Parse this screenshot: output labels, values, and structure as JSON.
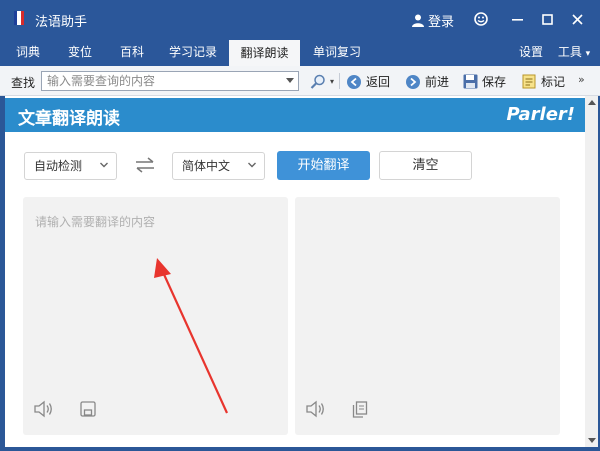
{
  "window": {
    "title": "法语助手",
    "login": "登录"
  },
  "nav": {
    "tabs": [
      "词典",
      "变位",
      "百科",
      "学习记录",
      "翻译朗读",
      "单词复习"
    ],
    "active_tab": "翻译朗读",
    "settings": "设置",
    "tools": "工具"
  },
  "toolbar": {
    "find_label": "查找",
    "search_placeholder": "输入需要查询的内容",
    "back": "返回",
    "forward": "前进",
    "save": "保存",
    "bookmark": "标记"
  },
  "translate": {
    "title": "文章翻译朗读",
    "logo": "Parler!",
    "source_lang": "自动检测",
    "target_lang": "简体中文",
    "start": "开始翻译",
    "clear": "清空",
    "input_placeholder": "请输入需要翻译的内容"
  },
  "colors": {
    "titlebar": "#2b579a",
    "banner": "#2b8ccc",
    "primary_button": "#3f92d8",
    "arrow": "#e8352e"
  }
}
